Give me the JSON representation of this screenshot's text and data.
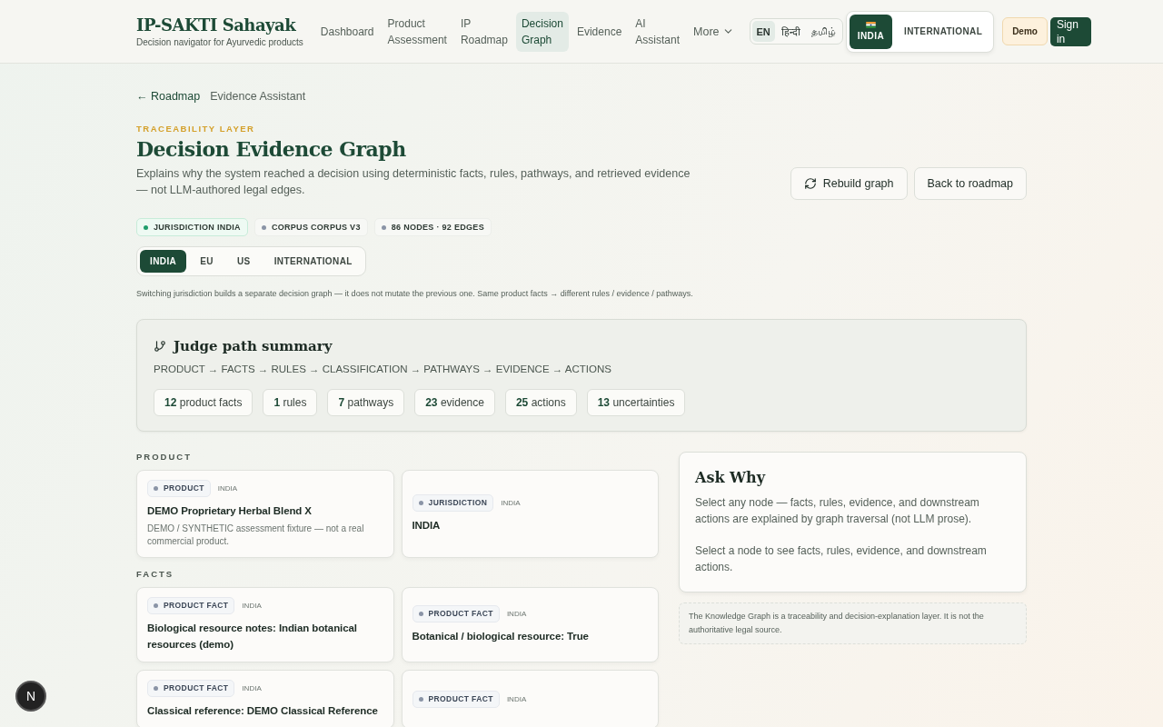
{
  "brand": {
    "title": "IP-SAKTI Sahayak",
    "subtitle": "Decision navigator for Ayurvedic products"
  },
  "nav": [
    {
      "label": "Dashboard",
      "selected": false
    },
    {
      "label": "Product Assessment",
      "selected": false
    },
    {
      "label": "IP Roadmap",
      "selected": false
    },
    {
      "label": "Decision Graph",
      "selected": true
    },
    {
      "label": "Evidence",
      "selected": false
    },
    {
      "label": "AI Assistant",
      "selected": false
    }
  ],
  "more": "More",
  "languages": [
    {
      "label": "EN",
      "selected": true
    },
    {
      "label": "हिन्दी",
      "selected": false
    },
    {
      "label": "தமிழ்",
      "selected": false
    }
  ],
  "regions": [
    {
      "label": "INDIA",
      "selected": true,
      "flag": true
    },
    {
      "label": "INTERNATIONAL",
      "selected": false,
      "flag": false
    }
  ],
  "demo_button": "Demo",
  "signin_button": "Sign in",
  "breadcrumbs": [
    {
      "label": "← Roadmap"
    },
    {
      "label": "Evidence Assistant"
    }
  ],
  "eyebrow": "TRACEABILITY LAYER",
  "title": "Decision Evidence Graph",
  "description": "Explains why the system reached a decision using deterministic facts, rules, pathways, and retrieved evidence — not LLM-authored legal edges.",
  "actions": [
    "Rebuild graph",
    "Back to roadmap"
  ],
  "badges": [
    {
      "label": "JURISDICTION INDIA",
      "color": "#1f9d6b"
    },
    {
      "label": "CORPUS CORPUS V3",
      "color": "#8a94a6"
    },
    {
      "label": "86 NODES · 92 EDGES",
      "color": "#8a94a6"
    }
  ],
  "jurisdiction_tabs": [
    {
      "label": "INDIA",
      "selected": true
    },
    {
      "label": "EU",
      "selected": false
    },
    {
      "label": "US",
      "selected": false
    },
    {
      "label": "INTERNATIONAL",
      "selected": false
    }
  ],
  "jurisdiction_note": "Switching jurisdiction builds a separate decision graph — it does not mutate the previous one. Same product facts → different rules / evidence / pathways.",
  "summary": {
    "title": "Judge path summary",
    "path": "PRODUCT → FACTS → RULES → CLASSIFICATION → PATHWAYS → EVIDENCE → ACTIONS",
    "stats": [
      {
        "count": "12",
        "label": "product facts"
      },
      {
        "count": "1",
        "label": "rules"
      },
      {
        "count": "7",
        "label": "pathways"
      },
      {
        "count": "23",
        "label": "evidence"
      },
      {
        "count": "25",
        "label": "actions"
      },
      {
        "count": "13",
        "label": "uncertainties"
      }
    ]
  },
  "sections": [
    {
      "heading": "PRODUCT",
      "nodes": [
        {
          "tag": "PRODUCT",
          "region": "INDIA",
          "title": "DEMO Proprietary Herbal Blend X",
          "detail": "DEMO / SYNTHETIC assessment fixture — not a real commercial product."
        },
        {
          "tag": "JURISDICTION",
          "region": "INDIA",
          "title": "INDIA"
        }
      ]
    },
    {
      "heading": "FACTS",
      "nodes": [
        {
          "tag": "PRODUCT FACT",
          "region": "INDIA",
          "title": "Biological resource notes: Indian botanical resources (demo)"
        },
        {
          "tag": "PRODUCT FACT",
          "region": "INDIA",
          "title": "Botanical / biological resource: True"
        },
        {
          "tag": "PRODUCT FACT",
          "region": "INDIA",
          "title": "Classical reference: DEMO Classical Reference"
        },
        {
          "tag": "PRODUCT FACT",
          "region": "INDIA"
        }
      ]
    }
  ],
  "ask_why": {
    "title": "Ask Why",
    "paragraphs": [
      "Select any node — facts, rules, evidence, and downstream actions are explained by graph traversal (not LLM prose).",
      "Select a node to see facts, rules, evidence, and downstream actions."
    ]
  },
  "disclaimer": "The Knowledge Graph is a traceability and decision-explanation layer. It is not the authoritative legal source.",
  "fab": "N"
}
